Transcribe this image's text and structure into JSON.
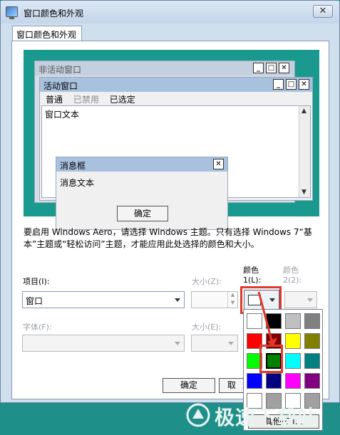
{
  "window": {
    "title": "窗口颜色和外观",
    "close": "✕"
  },
  "tab": {
    "label": "窗口颜色和外观"
  },
  "preview": {
    "inactive_title": "非活动窗口",
    "active_title": "活动窗口",
    "menu": {
      "normal": "普通",
      "disabled": "已禁用",
      "selected": "已选定"
    },
    "window_text": "窗口文本",
    "msgbox_title": "消息框",
    "msgbox_text": "消息文本",
    "ok": "确定",
    "min": "_",
    "max": "□",
    "close": "✕"
  },
  "description": "要启用 Windows Aero，请选择 Windows 主题。只有选择 Windows 7“基本”主题或“轻松访问”主题，才能应用此处选择的颜色和大小。",
  "item": {
    "label": "项目(I):",
    "value": "窗口"
  },
  "size_z": {
    "label": "大小(Z):"
  },
  "color1": {
    "label1": "颜色",
    "label2": "1(L):",
    "swatch": "#ffffff"
  },
  "color2": {
    "label1": "颜色",
    "label2": "2(2):"
  },
  "font": {
    "label": "字体(F):"
  },
  "size_e": {
    "label": "大小(E):"
  },
  "buttons": {
    "ok": "确定",
    "cancel": "取"
  },
  "palette": {
    "colors": [
      "#ffffff",
      "#000000",
      "#c0c0c0",
      "#808080",
      "#ff0000",
      "#800000",
      "#ffff00",
      "#808000",
      "#00ff00",
      "#008000",
      "#00ffff",
      "#008080",
      "#0000ff",
      "#000080",
      "#ff00ff",
      "#800080",
      "#ffffff",
      "#a0a0a0",
      "#ffffff",
      "#a0a0a0"
    ],
    "selected": "#008000",
    "other": "其他(O)..."
  },
  "watermark": "极速下载站"
}
